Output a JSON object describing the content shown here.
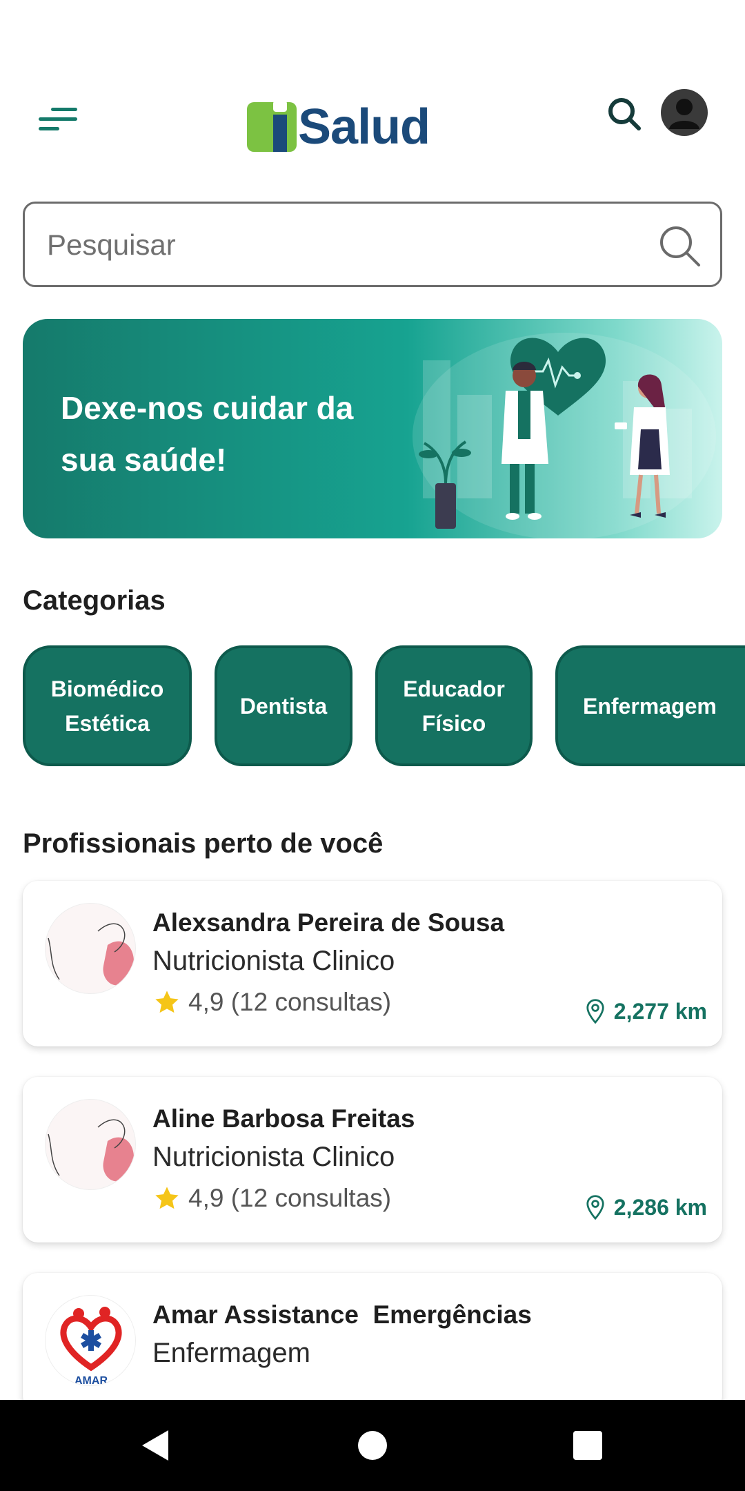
{
  "header": {
    "logo_text": "Salud",
    "menu_icon": "menu-icon",
    "search_icon": "search-icon",
    "avatar_icon": "user-avatar-icon"
  },
  "search": {
    "placeholder": "Pesquisar"
  },
  "banner": {
    "text": "Dexe-nos cuidar da sua saúde!"
  },
  "categories": {
    "title": "Categorias",
    "items": [
      {
        "label": "Biomédico Estética"
      },
      {
        "label": "Dentista"
      },
      {
        "label": "Educador Físico"
      },
      {
        "label": "Enfermagem"
      }
    ]
  },
  "professionals": {
    "title": "Profissionais perto de você",
    "items": [
      {
        "name": "Alexsandra Pereira de Sousa",
        "specialty": "Nutricionista Clinico",
        "rating": "4,9 (12 consultas)",
        "distance": "2,277 km"
      },
      {
        "name": "Aline Barbosa Freitas",
        "specialty": "Nutricionista Clinico",
        "rating": "4,9 (12 consultas)",
        "distance": "2,286 km"
      },
      {
        "name": "Amar Assistance  Emergências",
        "specialty": "Enfermagem",
        "logo_text": "AMAR"
      }
    ]
  },
  "colors": {
    "primary": "#157261",
    "brand_green": "#7cc242",
    "brand_blue": "#1b4a7a",
    "star": "#f5c518"
  },
  "navbar": {
    "back_icon": "back-icon",
    "home_icon": "home-icon",
    "recents_icon": "recents-icon"
  }
}
